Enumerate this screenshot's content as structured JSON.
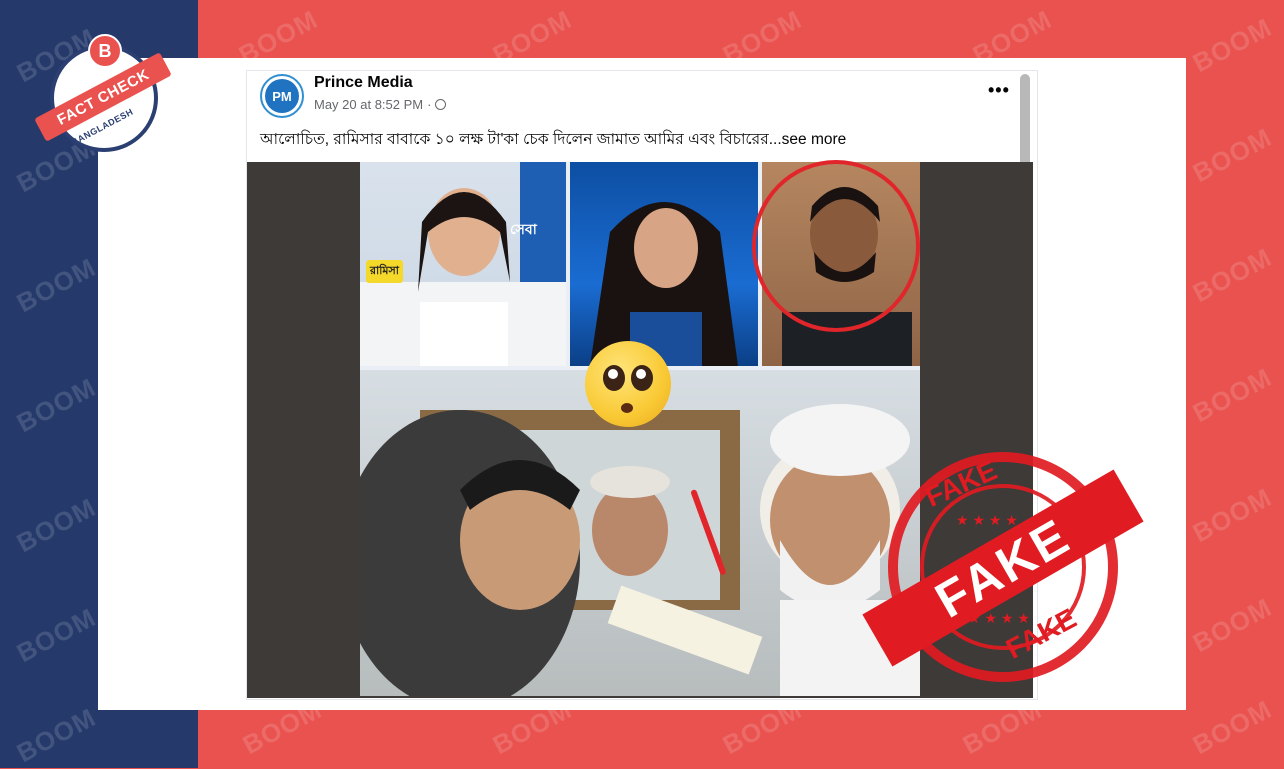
{
  "post": {
    "page_name": "Prince Media",
    "avatar_initials": "PM",
    "timestamp": "May 20 at 8:52 PM",
    "separator": "·",
    "caption": "আলোচিত, রামিসার বাবাকে ১০ লক্ষ টা'কা চেক দিলেন জামাত আমির এবং বিচারের...",
    "see_more": "see more",
    "more_options": "•••"
  },
  "media": {
    "label_girl": "রামিসা",
    "label_seba": "সেবা"
  },
  "badge": {
    "letter": "B",
    "ribbon": "FACT CHECK",
    "country": "BANGLADESH"
  },
  "stamp": {
    "center": "FAKE",
    "top": "FAKE",
    "bottom": "FAKE"
  },
  "watermark": {
    "text": "BOOM"
  },
  "colors": {
    "bg_left": "#253a6b",
    "bg_right": "#e9524e",
    "stamp_red": "#e01b22",
    "facebook_blue": "#1f73c1"
  }
}
